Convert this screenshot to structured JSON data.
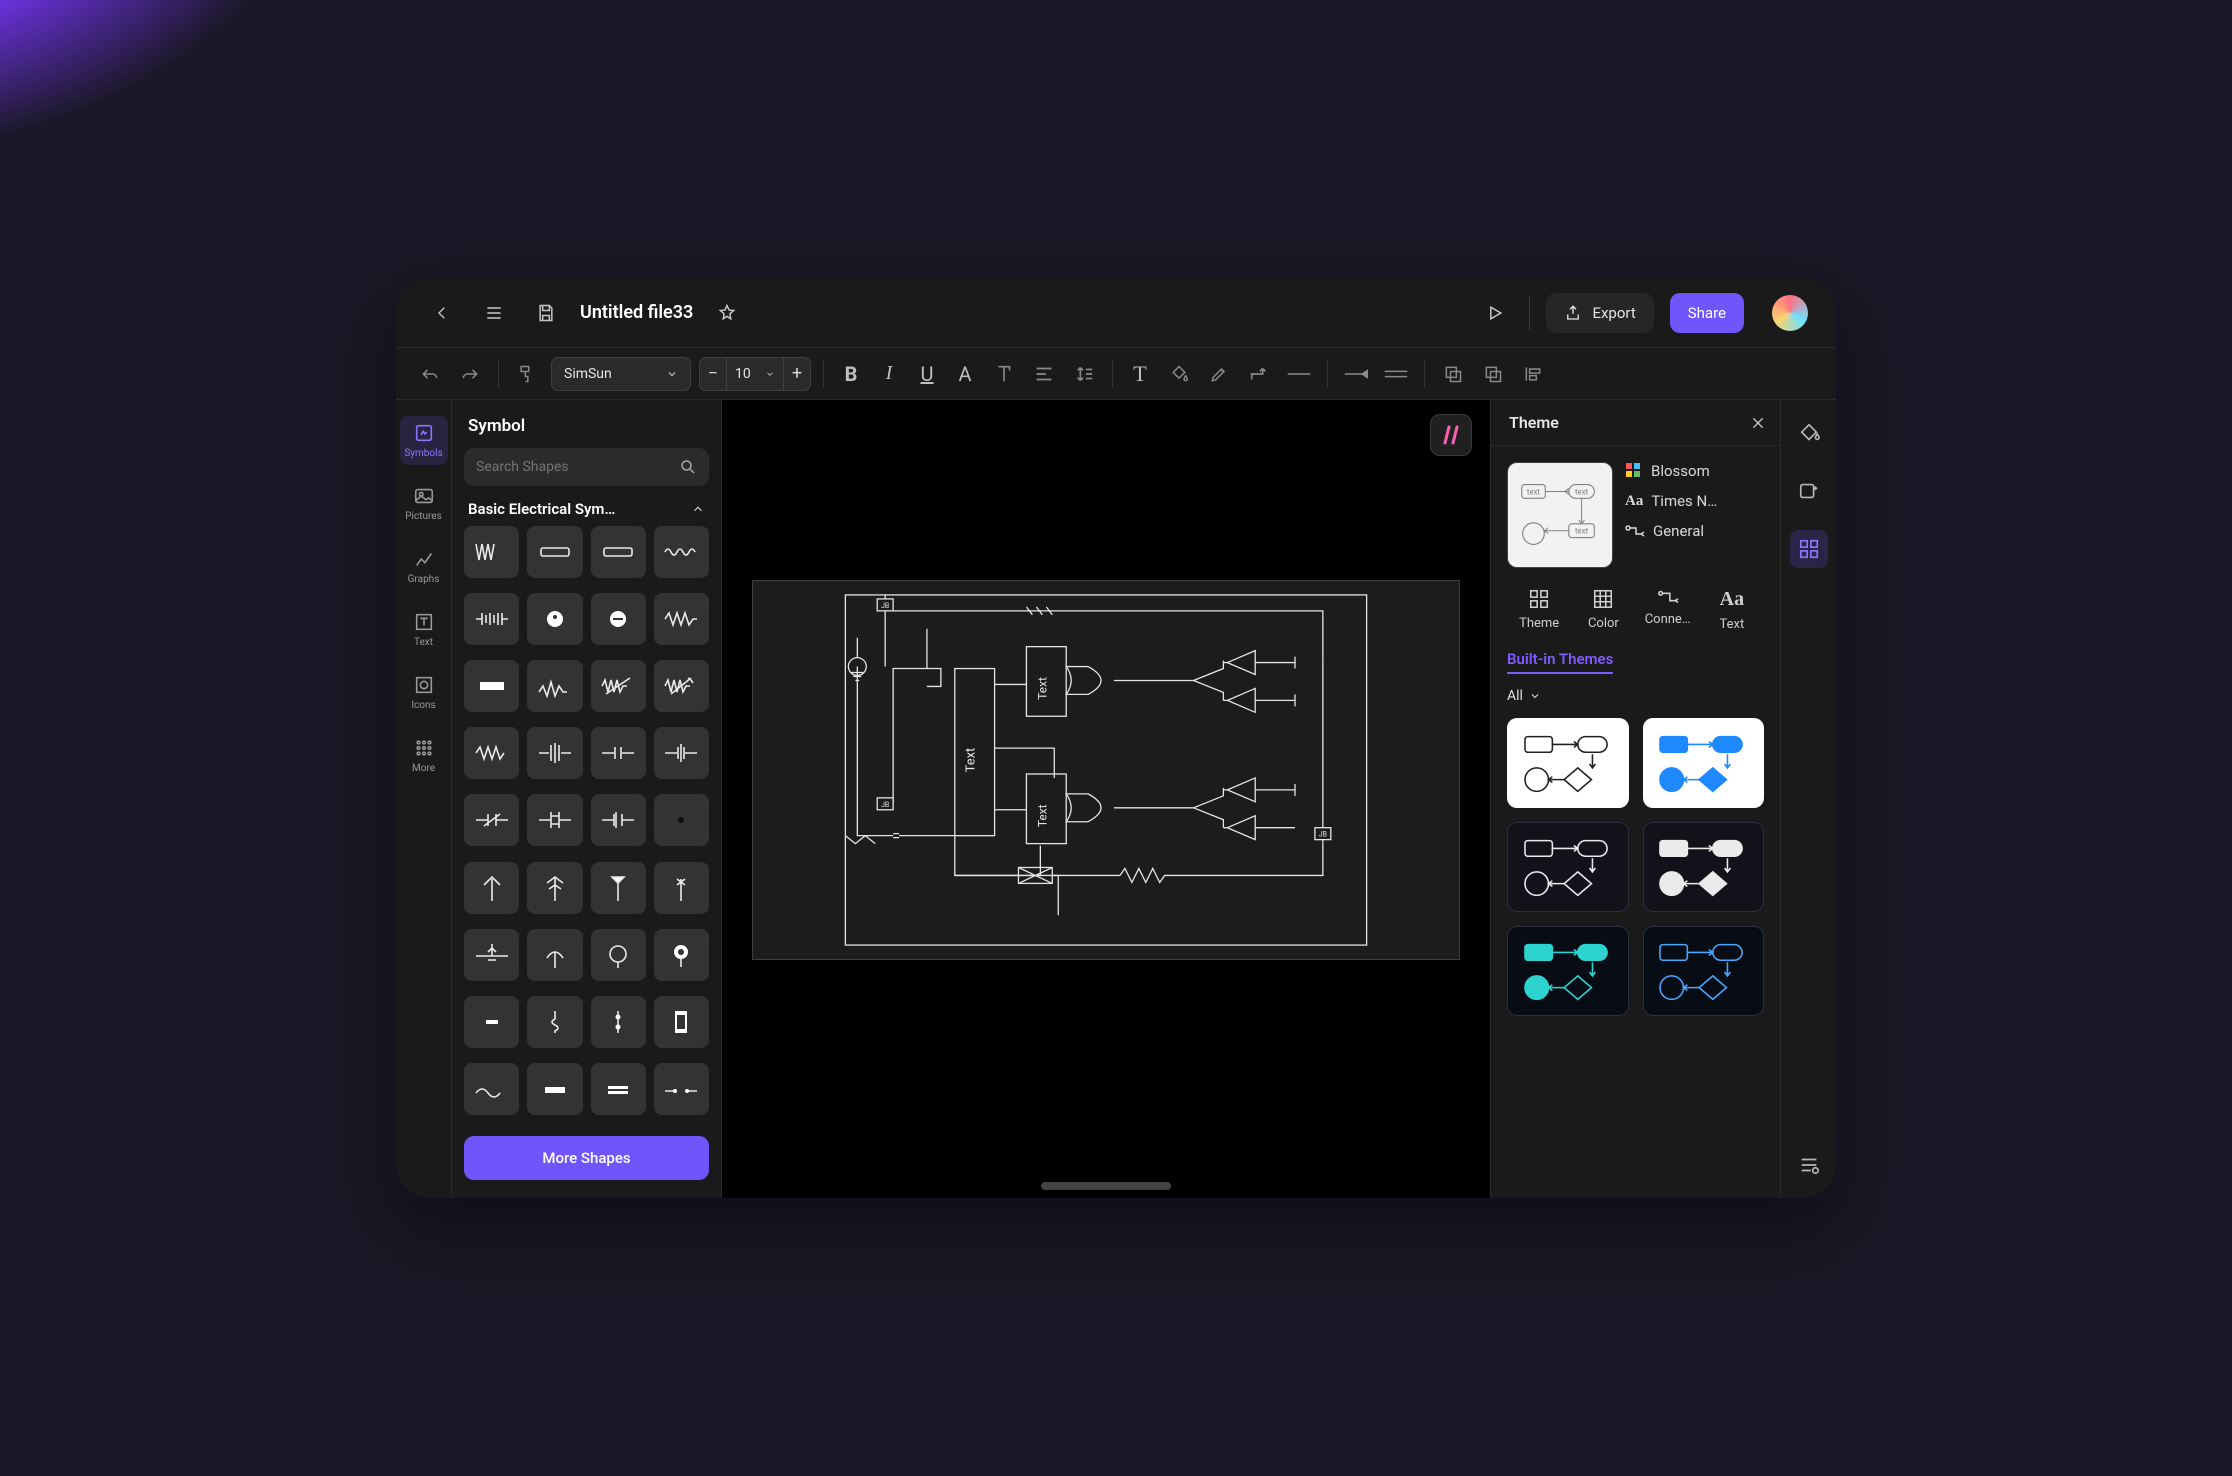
{
  "header": {
    "title": "Untitled file33",
    "export": "Export",
    "share": "Share"
  },
  "toolbar": {
    "font": "SimSun",
    "fontsize": "10"
  },
  "rail": {
    "symbols": "Symbols",
    "pictures": "Pictures",
    "graphs": "Graphs",
    "text": "Text",
    "icons": "Icons",
    "more": "More"
  },
  "panel": {
    "title": "Symbol",
    "search_ph": "Search Shapes",
    "category": "Basic Electrical Sym…",
    "more": "More Shapes"
  },
  "canvas": {
    "block1": "Text",
    "block2": "Text",
    "block3": "Text",
    "jb": "JB"
  },
  "rpanel": {
    "title": "Theme",
    "info_theme": "Blossom",
    "info_font": "Times N…",
    "info_conn": "General",
    "tab_theme": "Theme",
    "tab_color": "Color",
    "tab_conn": "Conne…",
    "tab_text": "Text",
    "builtins": "Built-in Themes",
    "filter": "All"
  }
}
